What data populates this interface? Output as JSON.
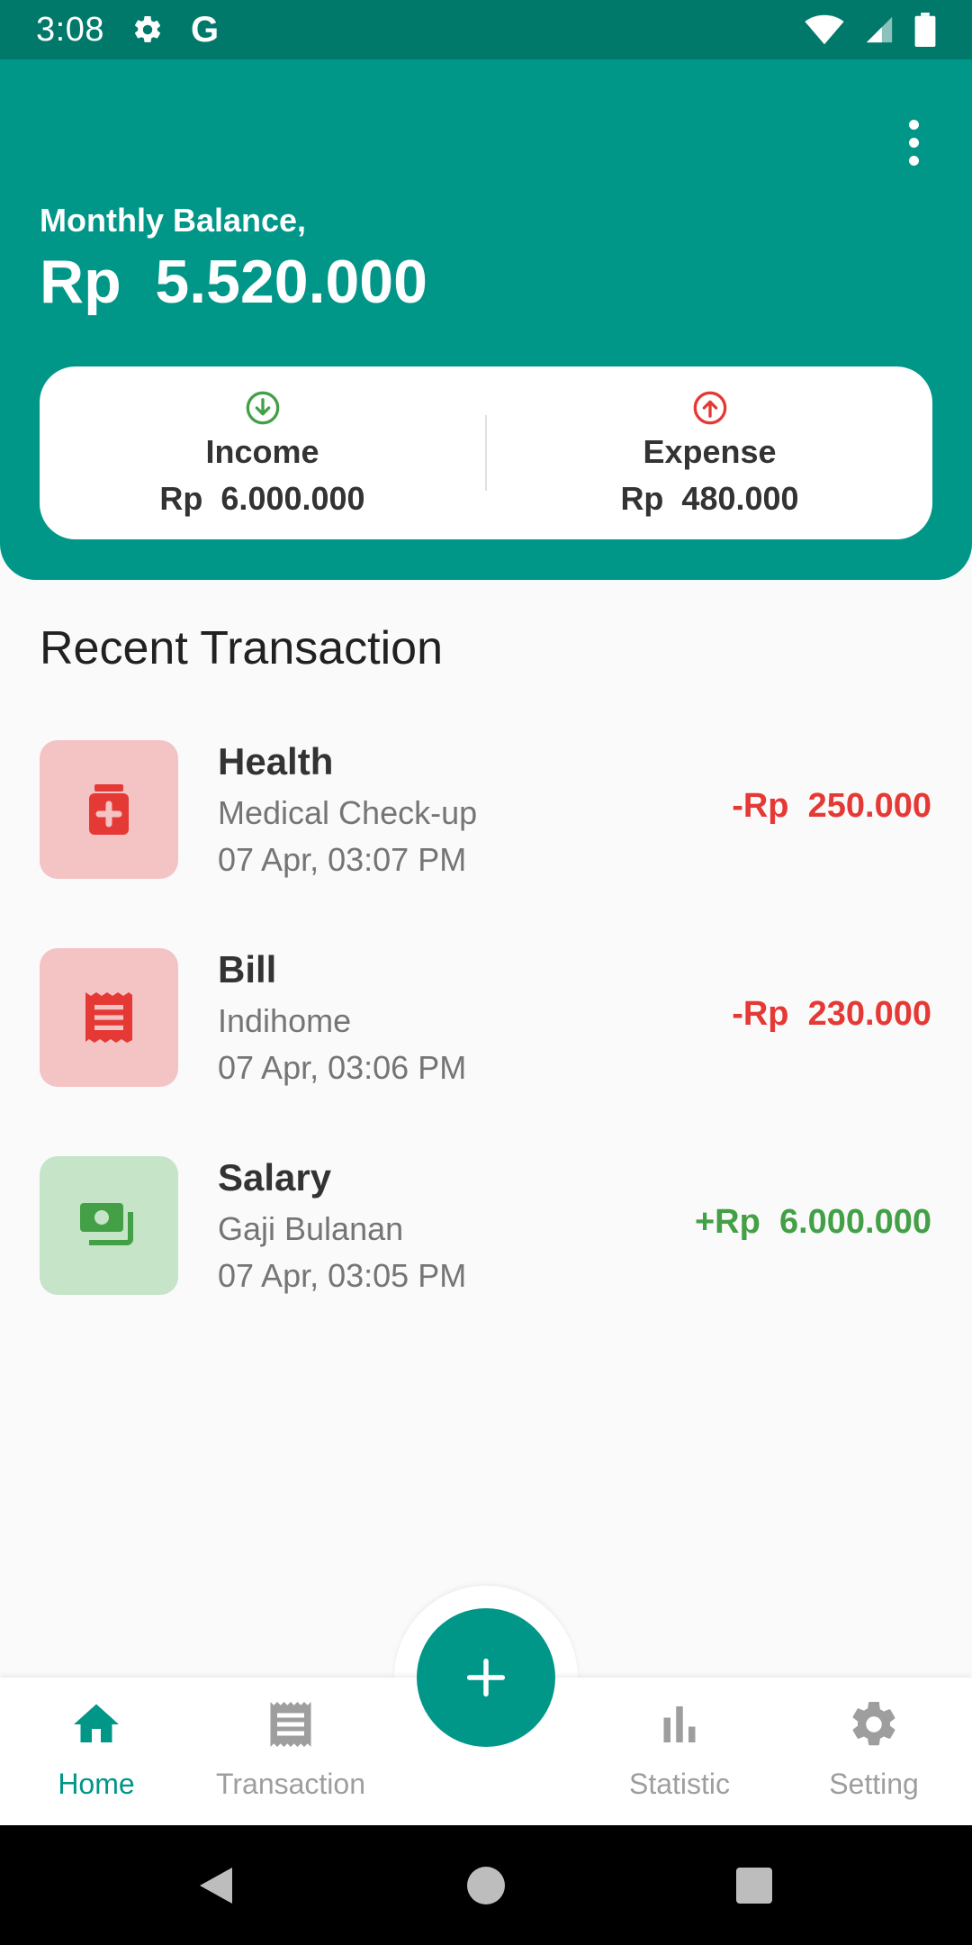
{
  "status_bar": {
    "time": "3:08",
    "g_label": "G",
    "icons": [
      "gear-icon",
      "google-icon",
      "wifi-icon",
      "signal-icon",
      "battery-icon"
    ]
  },
  "header": {
    "balance_label": "Monthly Balance,",
    "balance_value": "Rp  5.520.000",
    "menu_icon": "more-vert-icon",
    "income": {
      "title": "Income",
      "amount": "Rp  6.000.000",
      "icon": "arrow-down-circle-icon"
    },
    "expense": {
      "title": "Expense",
      "amount": "Rp  480.000",
      "icon": "arrow-up-circle-icon"
    }
  },
  "recent": {
    "title": "Recent Transaction",
    "items": [
      {
        "category": "Health",
        "description": "Medical Check-up",
        "date": "07 Apr, 03:07 PM",
        "amount": "-Rp  250.000",
        "type": "expense",
        "icon": "medicine-icon"
      },
      {
        "category": "Bill",
        "description": "Indihome",
        "date": "07 Apr, 03:06 PM",
        "amount": "-Rp  230.000",
        "type": "expense",
        "icon": "receipt-icon"
      },
      {
        "category": "Salary",
        "description": "Gaji Bulanan",
        "date": "07 Apr, 03:05 PM",
        "amount": "+Rp  6.000.000",
        "type": "income",
        "icon": "money-icon"
      }
    ]
  },
  "bottom_nav": {
    "items": [
      {
        "label": "Home",
        "icon": "home-icon",
        "active": true
      },
      {
        "label": "Transaction",
        "icon": "list-icon",
        "active": false
      },
      {
        "label": "Statistic",
        "icon": "bar-chart-icon",
        "active": false
      },
      {
        "label": "Setting",
        "icon": "gear-icon",
        "active": false
      }
    ],
    "fab_icon": "plus-icon"
  },
  "colors": {
    "primary": "#009688",
    "status_bar": "#00796b",
    "expense": "#e53935",
    "income": "#43a047",
    "expense_bg": "#f4c4c4",
    "income_bg": "#c6e4c7",
    "inactive": "#9e9e9e"
  }
}
